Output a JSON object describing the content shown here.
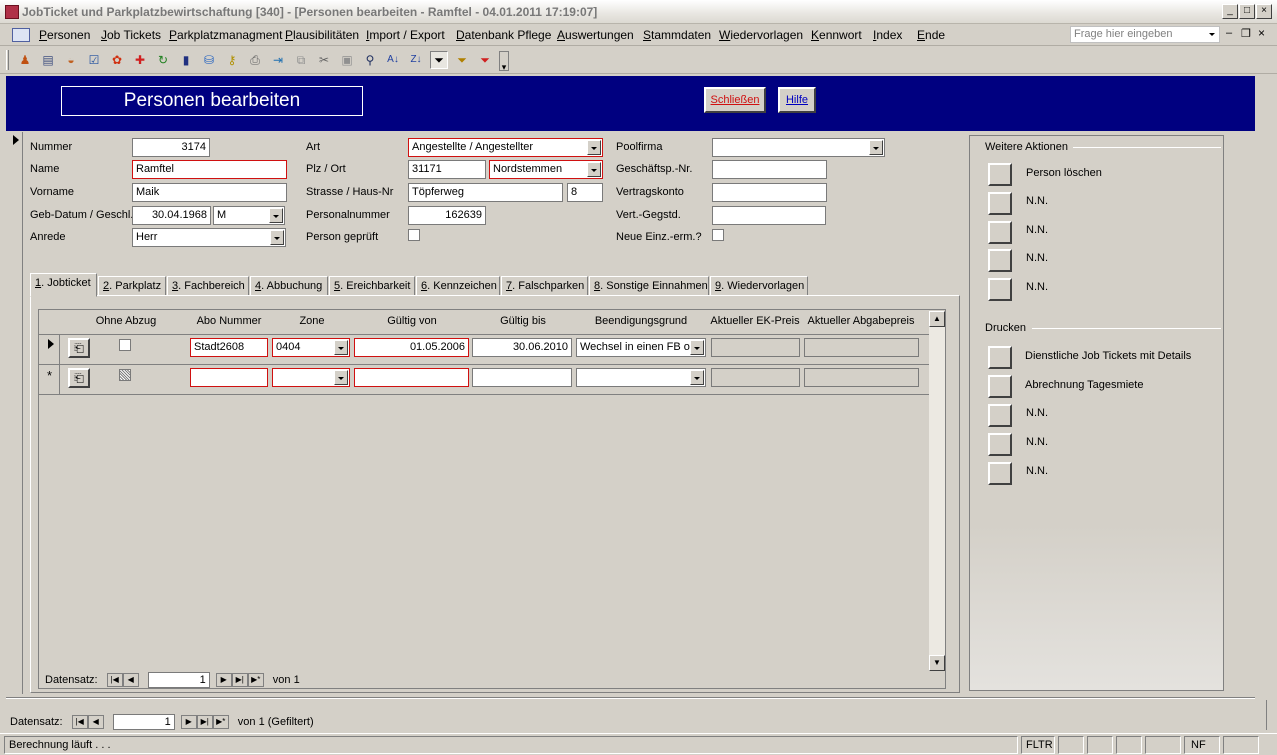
{
  "window": {
    "title": "JobTicket und Parkplatzbewirtschaftung [340] - [Personen bearbeiten - Ramftel - 04.01.2011 17:19:07]",
    "minimize": "_",
    "maximize": "□",
    "close": "×"
  },
  "menu": {
    "items": [
      {
        "u": "P",
        "rest": "ersonen"
      },
      {
        "u": "J",
        "rest": "ob Tickets"
      },
      {
        "u": "P",
        "rest": "arkplatzmanagment"
      },
      {
        "u": "P",
        "rest": "lausibilitäten"
      },
      {
        "u": "I",
        "rest": "mport / Export"
      },
      {
        "u": "D",
        "rest": "atenbank Pflege"
      },
      {
        "u": "A",
        "rest": "uswertungen"
      },
      {
        "u": "S",
        "rest": "tammdaten"
      },
      {
        "u": "W",
        "rest": "iedervorlagen"
      },
      {
        "u": "K",
        "rest": "ennwort"
      },
      {
        "u": "I",
        "rest": "ndex"
      },
      {
        "u": "E",
        "rest": "nde"
      }
    ],
    "ask_placeholder": "Frage hier eingeben"
  },
  "header": {
    "title": "Personen bearbeiten",
    "close_button": "Schließen",
    "help_button": "Hilfe"
  },
  "person": {
    "labels": {
      "nummer": "Nummer",
      "name": "Name",
      "vorname": "Vorname",
      "geb": "Geb-Datum / Geschl.",
      "anrede": "Anrede",
      "art": "Art",
      "plzort": "Plz / Ort",
      "strasse": "Strasse / Haus-Nr",
      "personalnummer": "Personalnummer",
      "geprueft": "Person geprüft",
      "poolfirma": "Poolfirma",
      "geschaeftsp": "Geschäftsp.-Nr.",
      "vertragskonto": "Vertragskonto",
      "vertgegstd": "Vert.-Gegstd.",
      "neueeinz": "Neue Einz.-erm.?"
    },
    "values": {
      "nummer": "3174",
      "name": "Ramftel",
      "vorname": "Maik",
      "geburtsdatum": "30.04.1968",
      "geschlecht": "M",
      "anrede": "Herr",
      "art": "Angestellte / Angestellter",
      "plz": "31171",
      "ort": "Nordstemmen",
      "strasse": "Töpferweg",
      "hausnr": "8",
      "personalnummer": "162639",
      "poolfirma": "",
      "geschaeftsp": "",
      "vertragskonto": "",
      "vertgegstd": ""
    }
  },
  "tabs": [
    {
      "u": "1",
      "rest": ". Jobticket"
    },
    {
      "u": "2",
      "rest": ". Parkplatz"
    },
    {
      "u": "3",
      "rest": ". Fachbereich"
    },
    {
      "u": "4",
      "rest": ". Abbuchung"
    },
    {
      "u": "5",
      "rest": ". Ereichbarkeit"
    },
    {
      "u": "6",
      "rest": ". Kennzeichen"
    },
    {
      "u": "7",
      "rest": ". Falschparken"
    },
    {
      "u": "8",
      "rest": ". Sonstige Einnahmen"
    },
    {
      "u": "9",
      "rest": ". Wiedervorlagen"
    }
  ],
  "grid": {
    "columns": [
      "Ohne Abzug",
      "Abo Nummer",
      "Zone",
      "Gültig von",
      "Gültig bis",
      "Beendigungsgrund",
      "Aktueller EK-Preis",
      "Aktueller Abgabepreis"
    ],
    "row": {
      "abo_nummer": "Stadt2608",
      "zone": "0404",
      "gueltig_von": "01.05.2006",
      "gueltig_bis": "30.06.2010",
      "beendigungsgrund": "Wechsel in einen FB oh"
    },
    "new_row_marker": "*",
    "nav": {
      "label": "Datensatz:",
      "current": "1",
      "of": "von",
      "total": "1"
    }
  },
  "actions": {
    "title": "Weitere Aktionen",
    "items": [
      "Person löschen",
      "N.N.",
      "N.N.",
      "N.N.",
      "N.N."
    ]
  },
  "print": {
    "title": "Drucken",
    "items": [
      "Dienstliche Job Tickets mit Details",
      "Abrechnung Tagesmiete",
      "N.N.",
      "N.N.",
      "N.N."
    ]
  },
  "record_nav": {
    "label": "Datensatz:",
    "current": "1",
    "of": "von",
    "total": "1 (Gefiltert)"
  },
  "status": {
    "message": "Berechnung läuft . . .",
    "fltr": "FLTR",
    "nf": "NF"
  }
}
